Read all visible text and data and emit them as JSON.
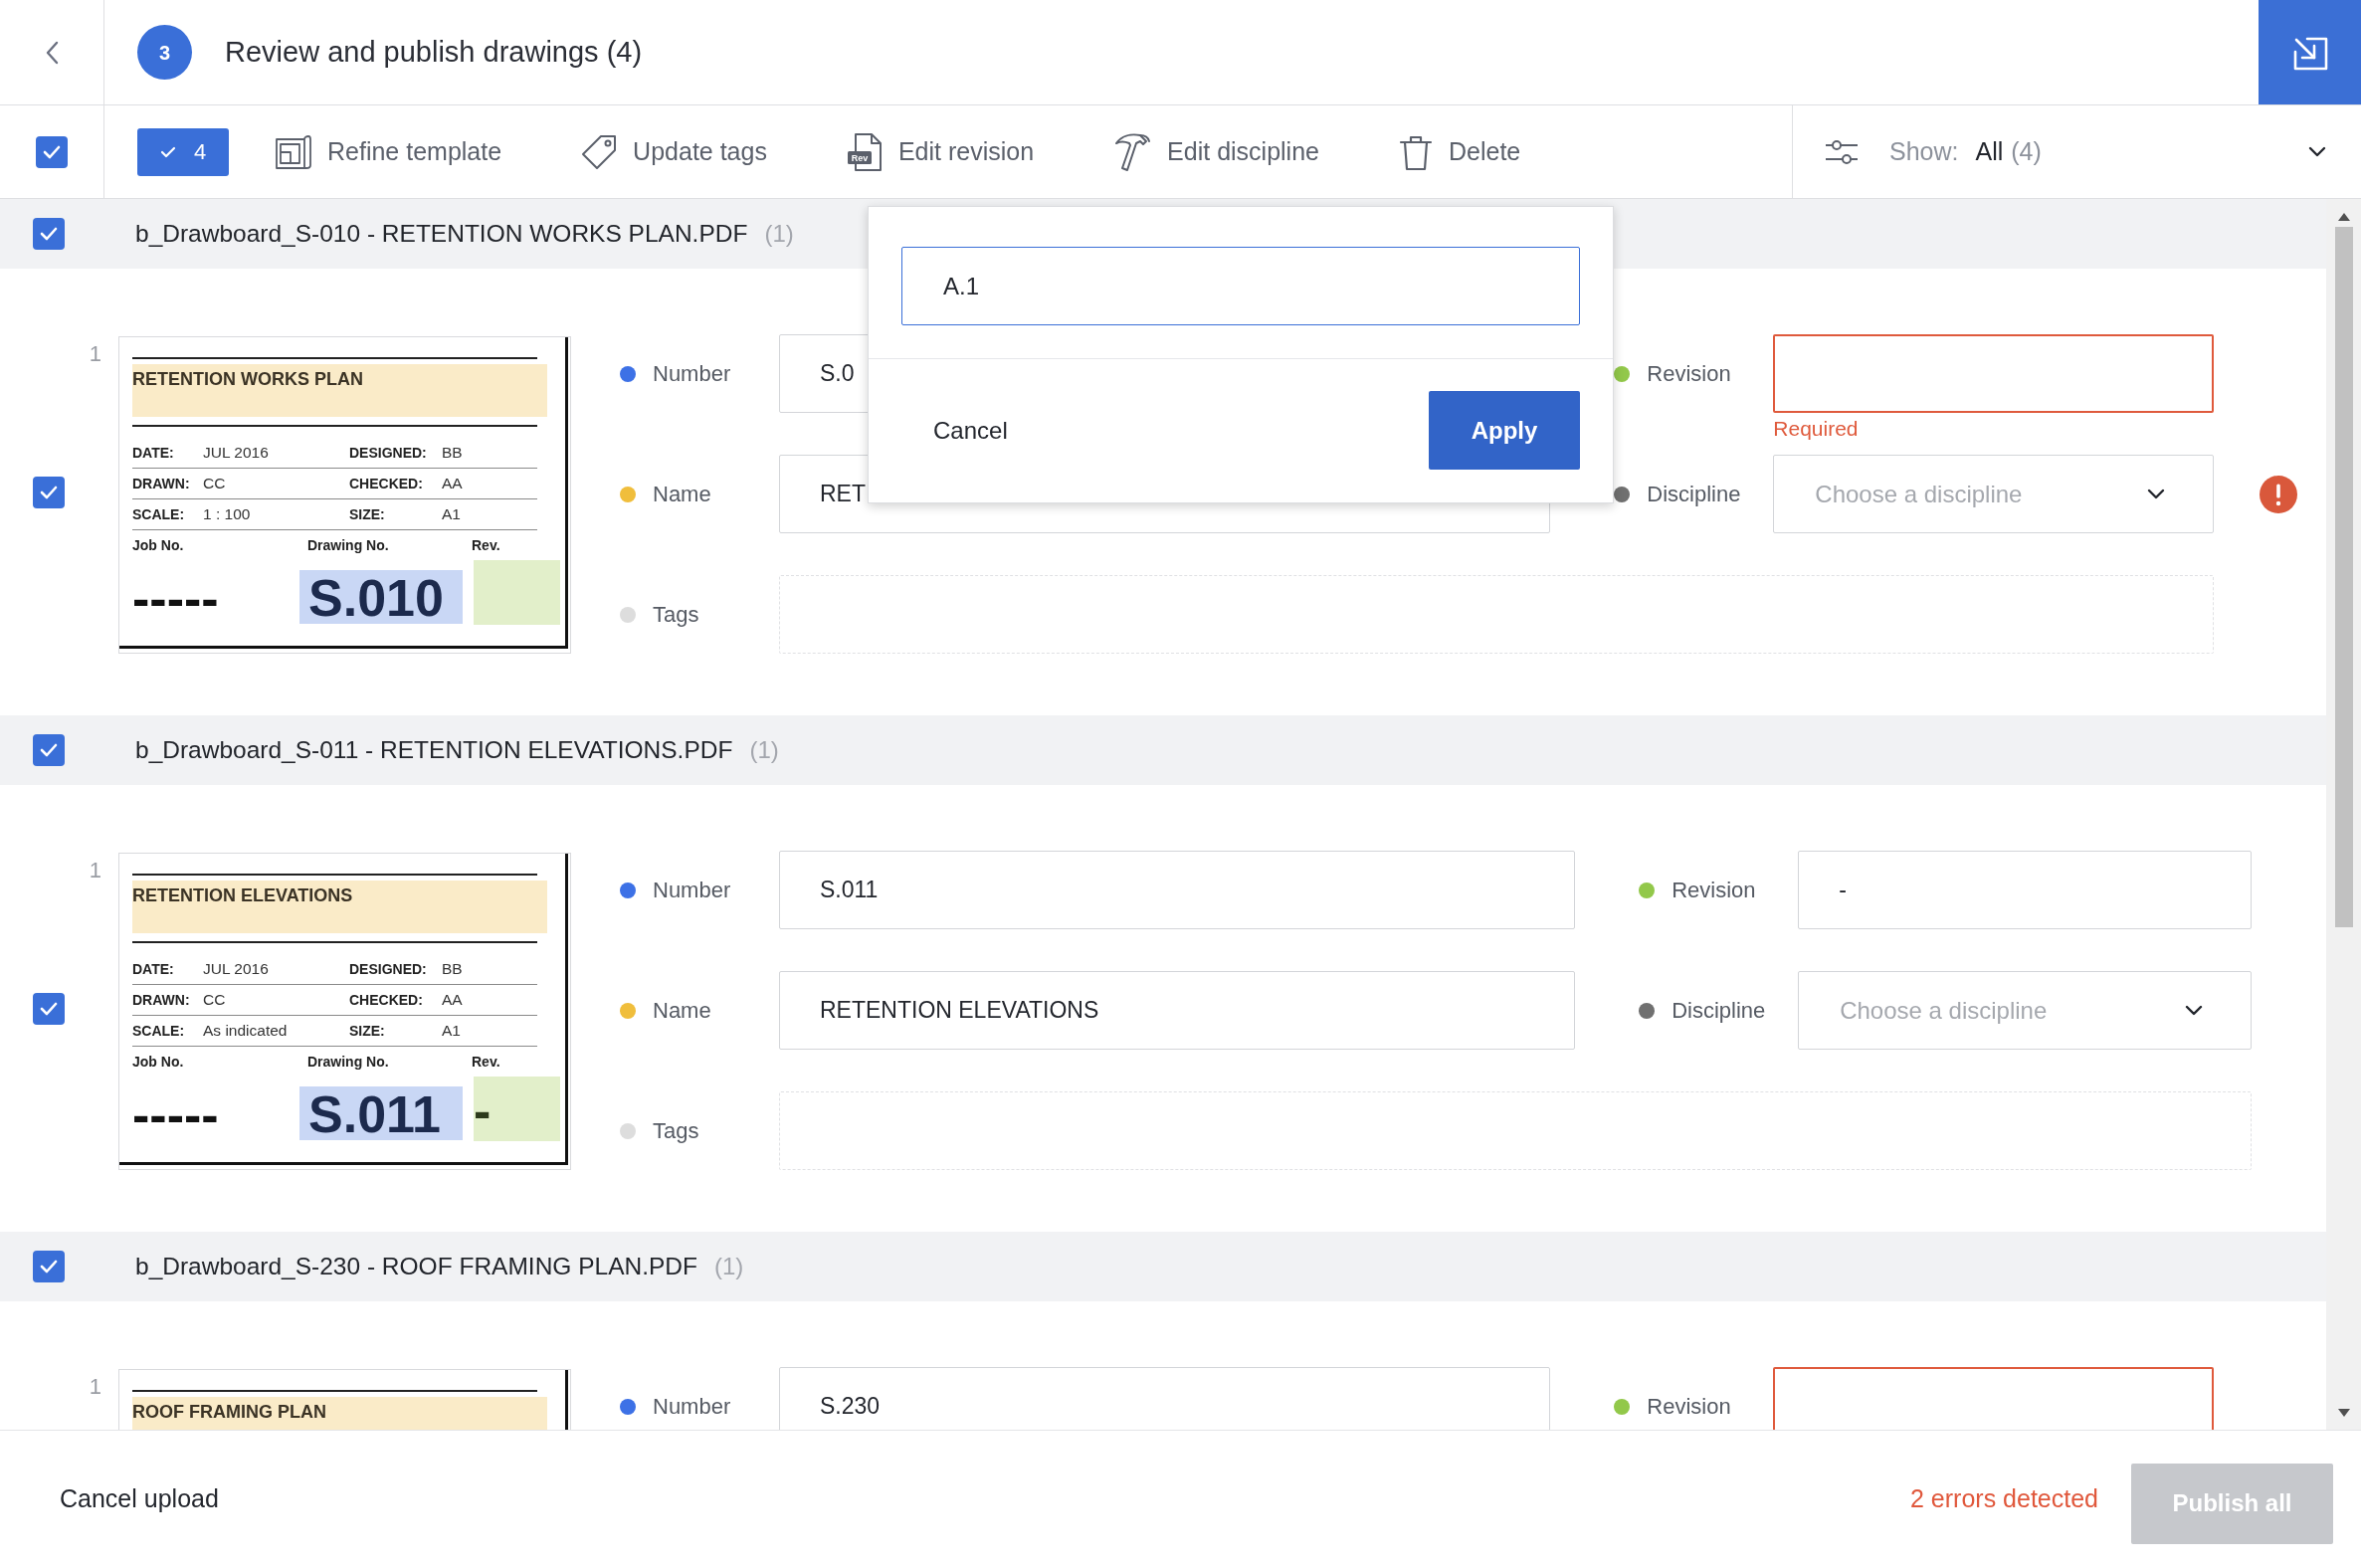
{
  "header": {
    "step": "3",
    "title": "Review and publish drawings (4)"
  },
  "toolbar": {
    "all_checked": true,
    "selected_count": "4",
    "actions": [
      {
        "kind": "template",
        "label": "Refine template"
      },
      {
        "kind": "tag",
        "label": "Update tags"
      },
      {
        "kind": "revision",
        "label": "Edit revision",
        "icon_text": "Rev"
      },
      {
        "kind": "discipline",
        "label": "Edit discipline"
      },
      {
        "kind": "delete",
        "label": "Delete"
      }
    ],
    "filter": {
      "label": "Show:",
      "value": "All",
      "count": "(4)"
    }
  },
  "groups": [
    {
      "checked": true,
      "file": "b_Drawboard_S-010 - RETENTION WORKS PLAN.PDF",
      "count": "(1)",
      "pages": [
        {
          "page": "1",
          "checked": true,
          "alert": true,
          "thumbnail": {
            "title": "RETENTION WORKS PLAN",
            "meta": [
              {
                "label": "DATE:",
                "value": "JUL 2016"
              },
              {
                "label": "DESIGNED:",
                "value": "BB"
              },
              {
                "label": "DRAWN:",
                "value": "CC"
              },
              {
                "label": "CHECKED:",
                "value": "AA"
              },
              {
                "label": "SCALE:",
                "value": "1 : 100"
              },
              {
                "label": "SIZE:",
                "value": "A1"
              }
            ],
            "job_label": "Job No.",
            "job_value": "-----",
            "drawing_label": "Drawing No.",
            "drawing_number": "S.010",
            "rev_label": "Rev."
          },
          "fields": [
            {
              "kind": "input",
              "label": "Number",
              "color": "#3d71e6",
              "error": false,
              "value": "S.0"
            },
            {
              "kind": "input",
              "label": "Revision",
              "color": "#92c84a",
              "error": true,
              "note": "Required"
            },
            {
              "kind": "input",
              "label": "Name",
              "color": "#f0be3c",
              "error": false,
              "value": "RET"
            },
            {
              "kind": "select",
              "label": "Discipline",
              "color": "#707070",
              "placeholder": "Choose a discipline"
            },
            {
              "kind": "tags",
              "label": "Tags",
              "color": "#dddddd"
            }
          ]
        }
      ]
    },
    {
      "checked": true,
      "file": "b_Drawboard_S-011 - RETENTION ELEVATIONS.PDF",
      "count": "(1)",
      "pages": [
        {
          "page": "1",
          "checked": true,
          "alert": false,
          "thumbnail": {
            "title": "RETENTION ELEVATIONS",
            "meta": [
              {
                "label": "DATE:",
                "value": "JUL 2016"
              },
              {
                "label": "DESIGNED:",
                "value": "BB"
              },
              {
                "label": "DRAWN:",
                "value": "CC"
              },
              {
                "label": "CHECKED:",
                "value": "AA"
              },
              {
                "label": "SCALE:",
                "value": "As indicated"
              },
              {
                "label": "SIZE:",
                "value": "A1"
              }
            ],
            "job_label": "Job No.",
            "job_value": "-----",
            "drawing_label": "Drawing No.",
            "drawing_number": "S.011",
            "rev_label": "Rev.",
            "rev_value": "-"
          },
          "fields": [
            {
              "kind": "input",
              "label": "Number",
              "color": "#3d71e6",
              "error": false,
              "value": "S.011"
            },
            {
              "kind": "input",
              "label": "Revision",
              "color": "#92c84a",
              "error": false,
              "value": "-"
            },
            {
              "kind": "input",
              "label": "Name",
              "color": "#f0be3c",
              "error": false,
              "value": "RETENTION ELEVATIONS"
            },
            {
              "kind": "select",
              "label": "Discipline",
              "color": "#707070",
              "placeholder": "Choose a discipline"
            },
            {
              "kind": "tags",
              "label": "Tags",
              "color": "#dddddd"
            }
          ]
        }
      ]
    },
    {
      "checked": true,
      "file": "b_Drawboard_S-230 - ROOF FRAMING PLAN.PDF",
      "count": "(1)",
      "pages": [
        {
          "page": "1",
          "thumbnail": {
            "title": "ROOF FRAMING PLAN"
          },
          "fields": [
            {
              "kind": "input",
              "label": "Number",
              "color": "#3d71e6",
              "error": false,
              "value": "S.230"
            },
            {
              "kind": "input",
              "label": "Revision",
              "color": "#92c84a",
              "error": true
            }
          ]
        }
      ]
    }
  ],
  "popup": {
    "value": "A.1",
    "cancel": "Cancel",
    "apply": "Apply"
  },
  "footer": {
    "cancel": "Cancel upload",
    "errors": "2 errors detected",
    "publish": {
      "label": "Publish all",
      "disabled": true
    }
  }
}
